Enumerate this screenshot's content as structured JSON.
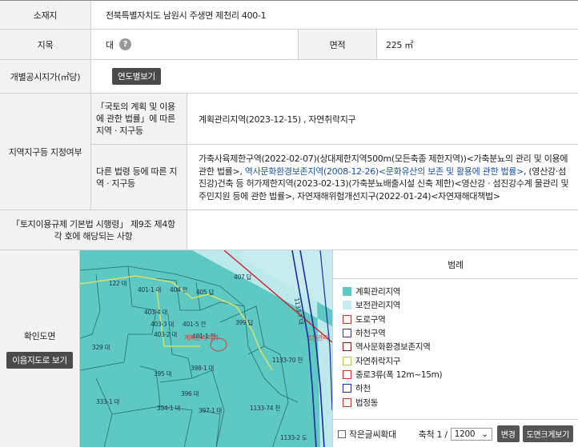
{
  "location": {
    "label": "소재지",
    "value": "전북특별자치도 남원시 주생면 제천리 400-1"
  },
  "land": {
    "label": "지목",
    "value": "대",
    "help_icon": "?",
    "area_label": "면적",
    "area_value": "225 ㎡"
  },
  "price": {
    "label": "개별공시지가(㎡당)",
    "button": "연도별보기"
  },
  "zoning": {
    "label": "지역지구등 지정여부",
    "sub1_label": "「국토의 계획 및 이용에 관한 법률」에 따른 지역 · 지구등",
    "sub1_value": "계획관리지역(2023-12-15) , 자연취락지구",
    "sub2_label": "다른 법령 등에 따른 지역 · 지구등",
    "sub2_text1": "가축사육제한구역(2022-02-07)(상대제한지역500m(모든축종 제한지역))<가축분뇨의 관리 및 이용에 관한 법률>, ",
    "sub2_link": "역사문화환경보존지역(2008-12-26)<문화유산의 보존 및 활용에 관한 법률>",
    "sub2_text2": ", (영산강·섬진강)건축 등 허가제한지역(2023-02-13)(가축분뇨배출시설 신축 제한)<영산강 · 섬진강수계 물관리 및 주민지원 등에 관한 법률>, 자연재해위험개선지구(2022-01-24)<자연재해대책법>"
  },
  "land_use_rule": {
    "label": "「토지이용규제 기본법 시행령」 제9조 제4항 각 호에 해당되는 사항",
    "value": ""
  },
  "map_section": {
    "label": "확인도면",
    "button": "이음지도로 보기",
    "parcels": [
      "122 대",
      "401-1 대",
      "404 전",
      "405 답",
      "407 답",
      "403-4 대",
      "403-3 대",
      "403-2 대",
      "401-5 전",
      "401-1 전",
      "399 답",
      "329 대",
      "395 대",
      "398-1 대",
      "1133-70 천",
      "396 대",
      "1133-74 천",
      "333-1 대",
      "394-1 대",
      "397-1 대",
      "1133-2 도",
      "1133-7 대"
    ],
    "map_labels": {
      "subject": "계획관리지역",
      "edge": "보전관리"
    },
    "legend_title": "범례",
    "legend": [
      {
        "label": "계획관리지역",
        "color": "#5ec8c2",
        "fill": true
      },
      {
        "label": "보전관리지역",
        "color": "#c7ecef",
        "fill": true
      },
      {
        "label": "도로구역",
        "color": "#c0392b",
        "fill": false
      },
      {
        "label": "하천구역",
        "color": "#3a3a8c",
        "fill": false
      },
      {
        "label": "역사문화환경보존지역",
        "color": "#8b1a1a",
        "fill": false
      },
      {
        "label": "자연취락지구",
        "color": "#b5cc4a",
        "fill": false
      },
      {
        "label": "중로3류(폭 12m~15m)",
        "color": "#e03030",
        "fill": false
      },
      {
        "label": "하천",
        "color": "#2a2a9c",
        "fill": false
      },
      {
        "label": "법정동",
        "color": "#c0392b",
        "fill": false
      }
    ],
    "zoom_label": "작은글씨확대",
    "scale_label": "축척 1 /",
    "scale_value": "1200",
    "change_button": "변경",
    "enlarge_button": "도면크게보기"
  }
}
